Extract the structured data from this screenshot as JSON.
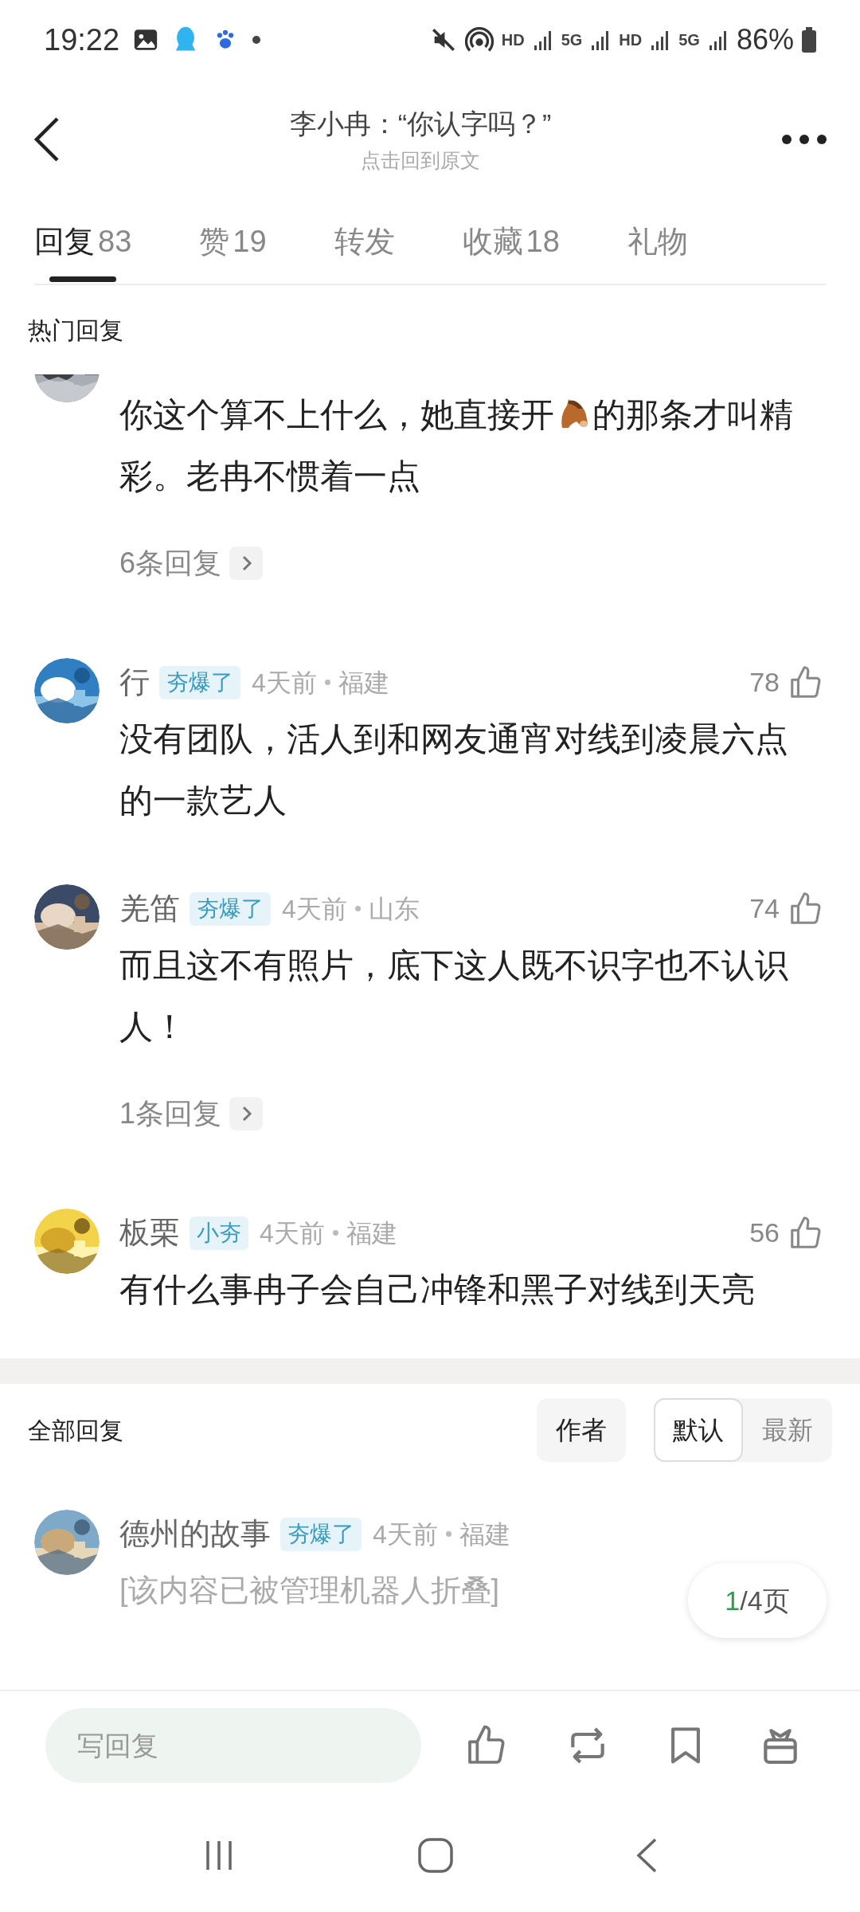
{
  "status_bar": {
    "time": "19:22",
    "indicators": [
      "HD",
      "5G",
      "HD",
      "5G"
    ],
    "battery": "86%"
  },
  "header": {
    "title": "李小冉：“你认字吗？”",
    "subtitle": "点击回到原文"
  },
  "tabs": [
    {
      "label": "回复",
      "count": "83",
      "selected": true
    },
    {
      "label": "赞",
      "count": "19",
      "selected": false
    },
    {
      "label": "转发",
      "selected": false
    },
    {
      "label": "收藏",
      "count": "18",
      "selected": false
    },
    {
      "label": "礼物",
      "selected": false
    }
  ],
  "hot_replies": {
    "title": "热门回复",
    "comments": [
      {
        "kind": "clipped",
        "segments": [
          {
            "kind": "text",
            "text": "你这个算不上什么，她直接开"
          },
          {
            "kind": "emoji"
          },
          {
            "kind": "text",
            "text": "的那条才叫精彩。老冉不惯着一点"
          }
        ],
        "replies": "6条回复"
      },
      {
        "kind": "normal",
        "name": "行",
        "badge": "夯爆了",
        "time": "4天前",
        "location": "福建",
        "likes": "78",
        "segments": [
          {
            "kind": "text",
            "text": "没有团队，活人到和网友通宵对线到凌晨六点的一款艺人"
          }
        ]
      },
      {
        "kind": "normal",
        "name": "羌笛",
        "badge": "夯爆了",
        "time": "4天前",
        "location": "山东",
        "likes": "74",
        "segments": [
          {
            "kind": "text",
            "text": "而且这不有照片，底下这人既不识字也不认识人！"
          }
        ],
        "replies": "1条回复"
      },
      {
        "kind": "normal",
        "name": "板栗",
        "badge": "小夯",
        "time": "4天前",
        "location": "福建",
        "likes": "56",
        "segments": [
          {
            "kind": "text",
            "text": "有什么事冉子会自己冲锋和黑子对线到天亮"
          }
        ]
      }
    ]
  },
  "all_replies": {
    "title": "全部回复",
    "author_filter": {
      "label": "作者",
      "selected": false
    },
    "sort_options": [
      {
        "label": "默认",
        "selected": true
      },
      {
        "label": "最新",
        "selected": false
      }
    ],
    "comments": [
      {
        "kind": "collapsed",
        "name": "德州的故事",
        "badge": "夯爆了",
        "time": "4天前",
        "location": "福建",
        "segments": [
          {
            "kind": "text",
            "text": "[该内容已被管理机器人折叠]"
          }
        ]
      }
    ]
  },
  "page_indicator": {
    "current": "1",
    "rest": "/4页"
  },
  "reply_bar": {
    "placeholder": "写回复"
  }
}
